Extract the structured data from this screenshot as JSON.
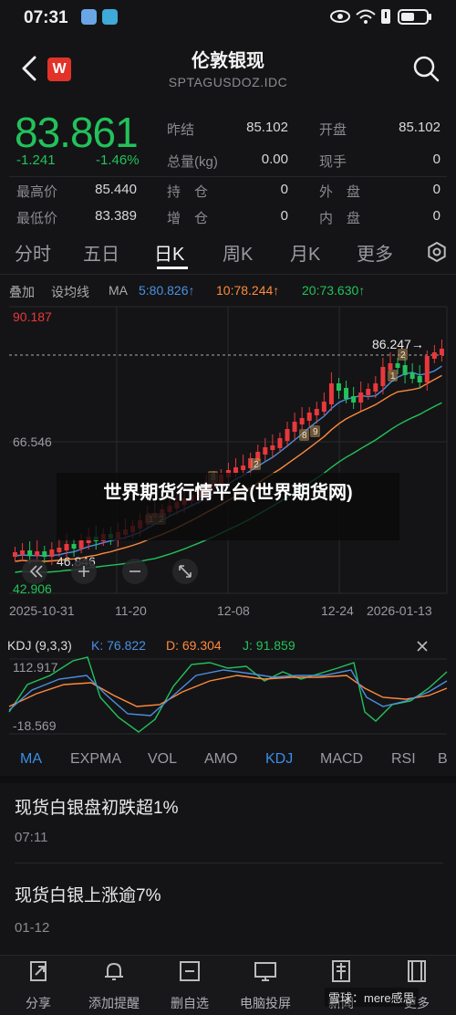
{
  "status_bar": {
    "time": "07:31"
  },
  "header": {
    "title": "伦敦银现",
    "subtitle": "SPTAGUSDOZ.IDC",
    "logo_text": "W"
  },
  "quote": {
    "price": "83.861",
    "change": "-1.241",
    "change_pct": "-1.46%",
    "fields": [
      {
        "label": "昨结",
        "value": "85.102"
      },
      {
        "label": "开盘",
        "value": "85.102"
      },
      {
        "label": "总量(kg)",
        "value": "0.00"
      },
      {
        "label": "现手",
        "value": "0"
      },
      {
        "label": "最高价",
        "value": "85.440"
      },
      {
        "label": "持　仓",
        "value": "0"
      },
      {
        "label": "外　盘",
        "value": "0"
      },
      {
        "label": "最低价",
        "value": "83.389"
      },
      {
        "label": "增　仓",
        "value": "0"
      },
      {
        "label": "内　盘",
        "value": "0"
      }
    ]
  },
  "period_tabs": [
    "分时",
    "五日",
    "日K",
    "周K",
    "月K",
    "更多"
  ],
  "ma_row": {
    "overlay": "叠加",
    "drawing": "设均线",
    "ma": "MA",
    "ma5": "5:80.826↑",
    "ma10": "10:78.244↑",
    "ma20": "20:73.630↑"
  },
  "colors": {
    "up": "#e8383c",
    "down": "#22c25a",
    "ma5": "#4a90e2",
    "ma10": "#ff8a3c",
    "ma20": "#22c25a"
  },
  "chart_data": {
    "type": "candlestick",
    "y_ticks": [
      "90.187",
      "66.546",
      "42.906"
    ],
    "x_ticks": [
      "2025-10-31",
      "11-20",
      "12-08",
      "12-24",
      "2026-01-13"
    ],
    "price_line_label": "86.247→",
    "low_marker": "46.846",
    "ylim": [
      42.906,
      90.187
    ]
  },
  "watermark": "世界期货行情平台(世界期货网)",
  "kdj": {
    "name": "KDJ (9,3,3)",
    "k": "K: 76.822",
    "d": "D: 69.304",
    "j": "J: 91.859",
    "y_top": "112.917",
    "y_bottom": "-18.569"
  },
  "indicator_tabs": [
    "MA",
    "EXPMA",
    "VOL",
    "AMO",
    "KDJ",
    "MACD",
    "RSI",
    "B"
  ],
  "news": [
    {
      "title": "现货白银盘初跌超1%",
      "time": "07:11"
    },
    {
      "title": "现货白银上涨逾7%",
      "time": "01-12"
    }
  ],
  "bottom_nav": [
    "分享",
    "添加提醒",
    "删自选",
    "电脑投屏",
    "新闻",
    "更多"
  ],
  "corner_mark": "雪球：mere感思"
}
